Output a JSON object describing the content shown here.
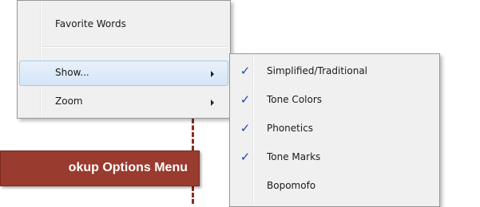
{
  "main_menu": {
    "items": [
      {
        "label": "Favorite Words",
        "has_submenu": false
      },
      {
        "label": "Show...",
        "has_submenu": true,
        "highlighted": true
      },
      {
        "label": "Zoom",
        "has_submenu": true
      }
    ]
  },
  "show_submenu": {
    "items": [
      {
        "label": "Simplified/Traditional",
        "checked": true
      },
      {
        "label": "Tone Colors",
        "checked": true
      },
      {
        "label": "Phonetics",
        "checked": true
      },
      {
        "label": "Tone Marks",
        "checked": true
      },
      {
        "label": "Bopomofo",
        "checked": false
      }
    ]
  },
  "callout": {
    "text": "okup Options Menu"
  },
  "icons": {
    "checkmark": "✓"
  },
  "colors": {
    "highlight": "#d5e5f6",
    "check": "#2244aa",
    "callout_bg": "#9a3b2f"
  }
}
